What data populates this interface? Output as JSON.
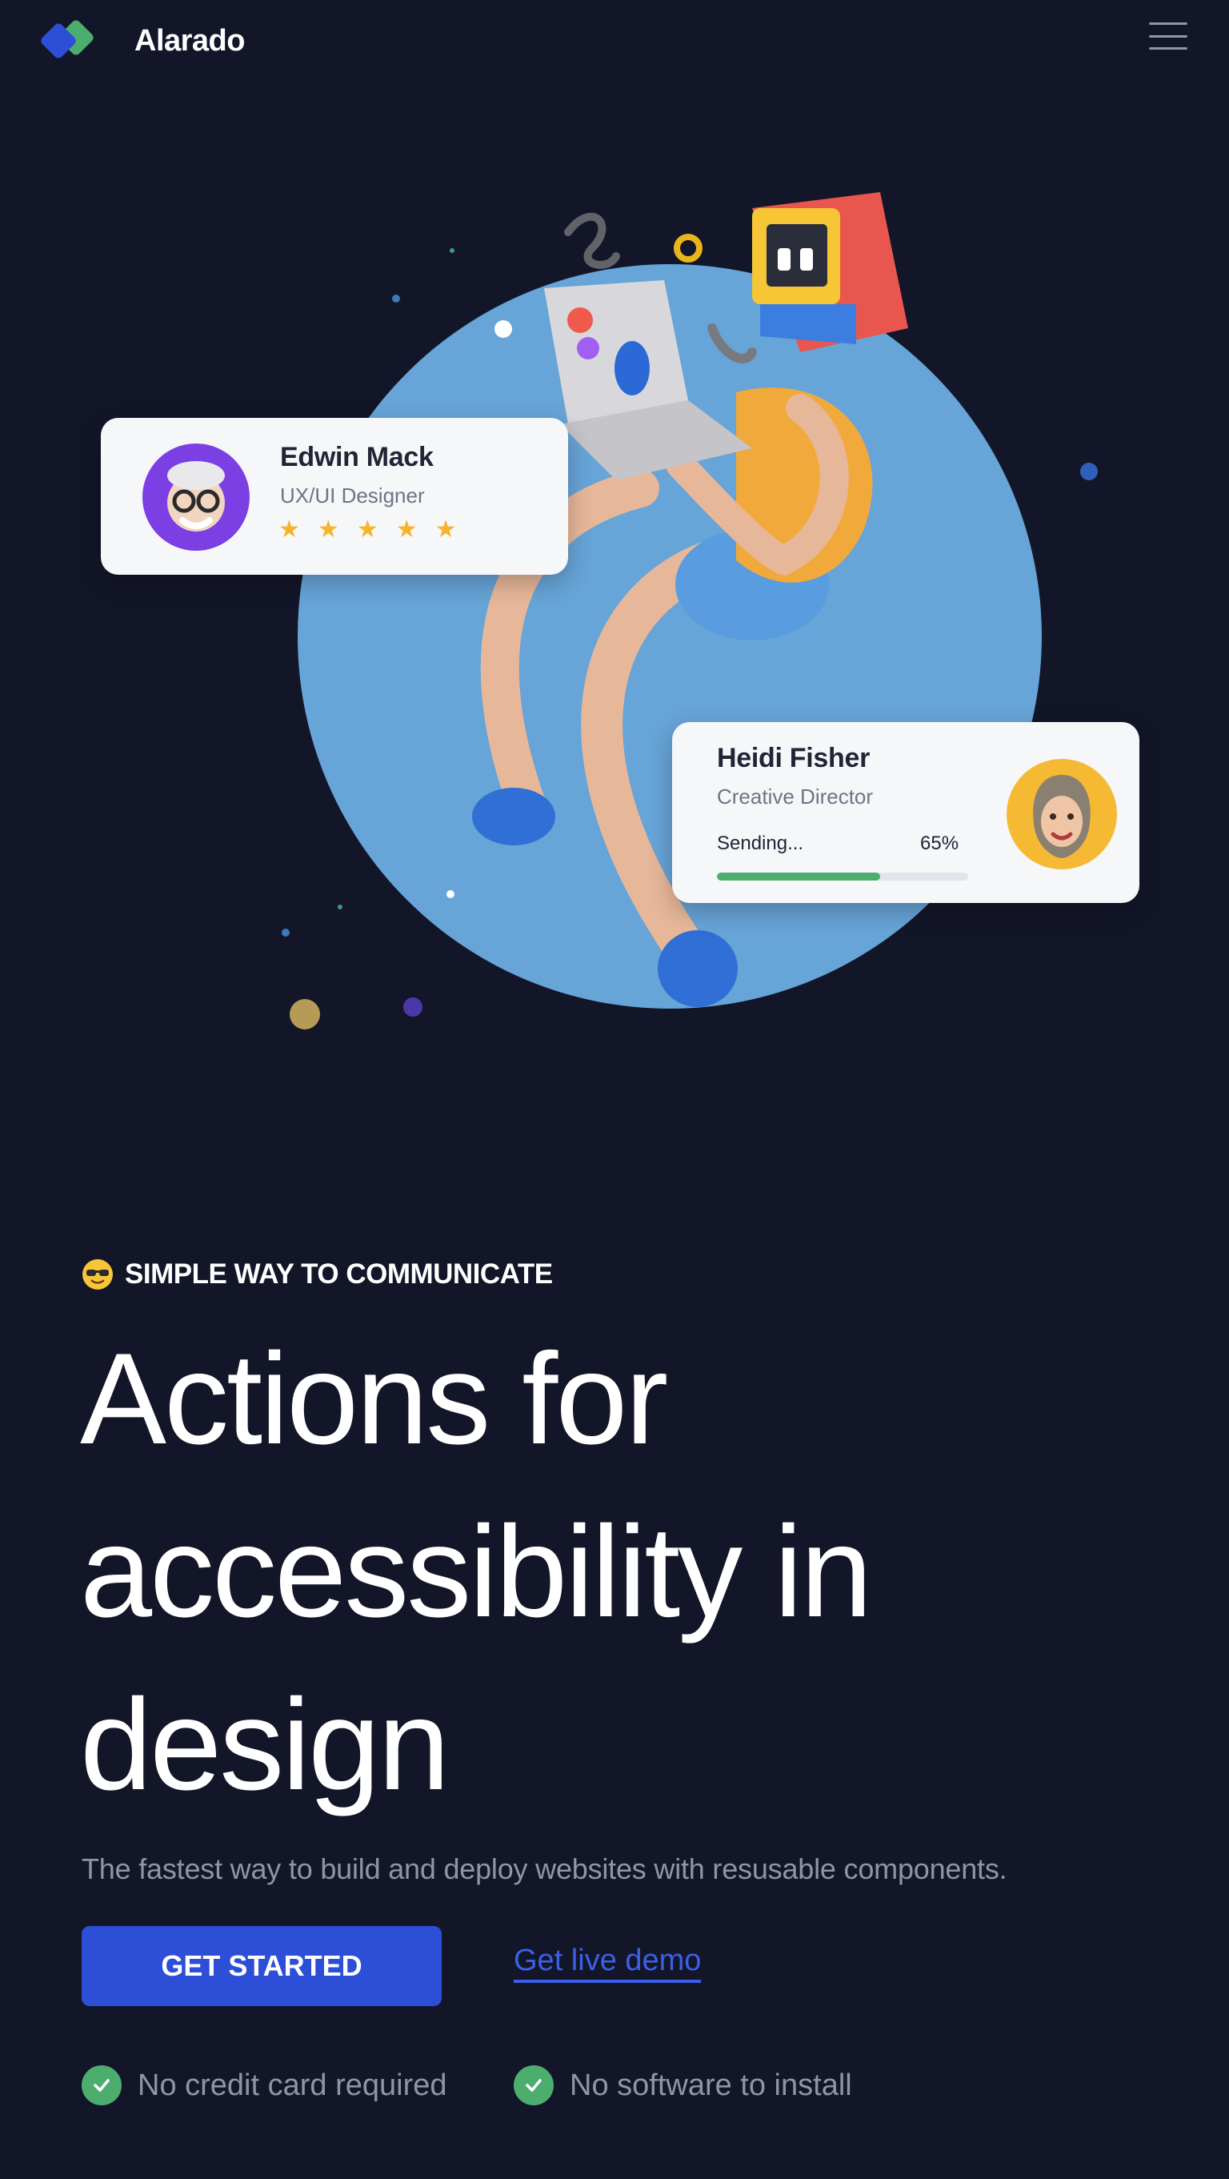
{
  "brand": {
    "name": "Alarado",
    "colors": {
      "primary": "#2d4fd8",
      "secondary": "#4cae6e"
    }
  },
  "header": {
    "menu_icon": "hamburger-menu-icon"
  },
  "hero": {
    "card_a": {
      "name": "Edwin Mack",
      "role": "UX/UI Designer",
      "rating": 5,
      "stars": [
        "★",
        "★",
        "★",
        "★",
        "★"
      ]
    },
    "card_b": {
      "name": "Heidi Fisher",
      "role": "Creative Director",
      "status": "Sending...",
      "progress_text": "65%",
      "progress": 0.65
    }
  },
  "content": {
    "eyebrow": "SIMPLE WAY TO COMMUNICATE",
    "eyebrow_icon": "sunglasses-emoji-icon",
    "headline": "Actions for accessibility in design",
    "lead": "The fastest way to build and deploy websites with resusable components.",
    "cta_primary": "GET STARTED",
    "cta_secondary": "Get live demo",
    "features": [
      "No credit card required",
      "No software to install"
    ]
  }
}
